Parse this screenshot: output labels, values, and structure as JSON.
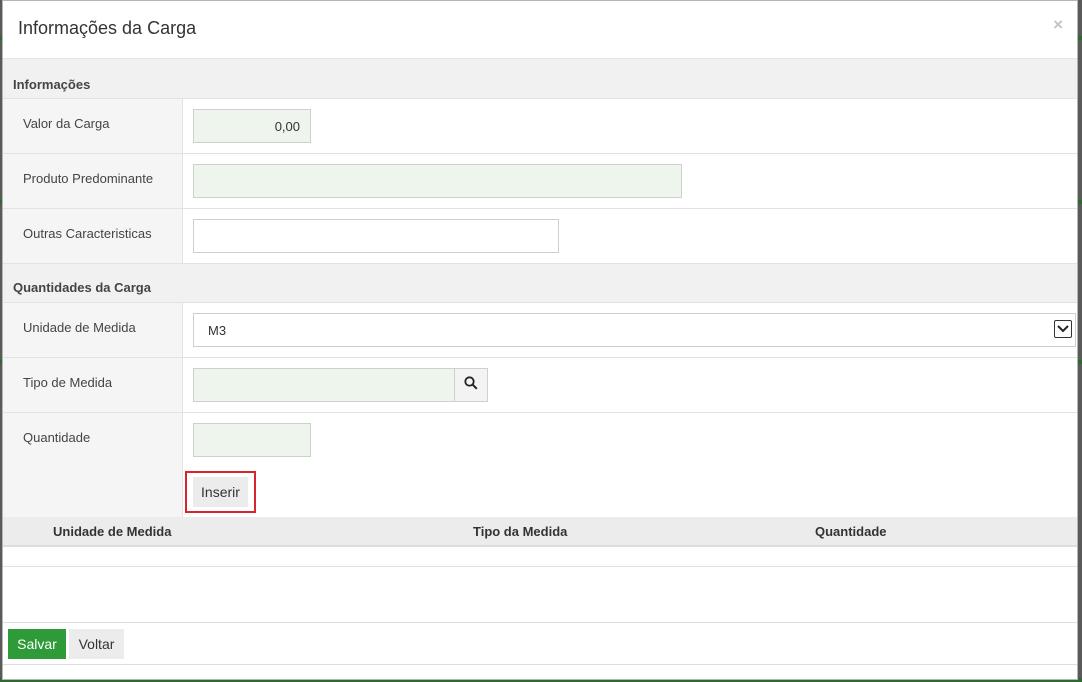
{
  "modal": {
    "title": "Informações da Carga",
    "close_label": "×"
  },
  "informacoes": {
    "section_title": "Informações",
    "valor_carga": {
      "label": "Valor da Carga",
      "value": "0,00"
    },
    "produto_predominante": {
      "label": "Produto Predominante",
      "value": ""
    },
    "outras_caracteristicas": {
      "label": "Outras Caracteristicas",
      "value": ""
    }
  },
  "quantidades": {
    "section_title": "Quantidades da Carga",
    "unidade_medida": {
      "label": "Unidade de Medida",
      "selected": "M3"
    },
    "tipo_medida": {
      "label": "Tipo de Medida",
      "value": "",
      "search_icon": "search-icon"
    },
    "quantidade": {
      "label": "Quantidade",
      "value": ""
    },
    "inserir_label": "Inserir"
  },
  "table": {
    "columns": [
      "Unidade de Medida",
      "Tipo da Medida",
      "Quantidade"
    ],
    "rows": []
  },
  "footer": {
    "salvar_label": "Salvar",
    "voltar_label": "Voltar"
  },
  "colors": {
    "primary_button": "#2e9b38",
    "input_fill": "#eef5ec",
    "highlight_border": "#d9232d"
  }
}
